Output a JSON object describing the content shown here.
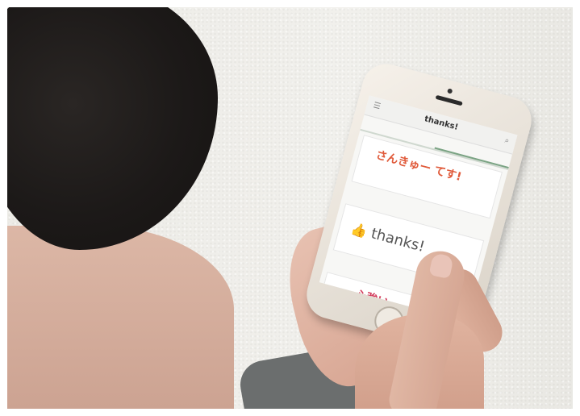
{
  "phone_screen": {
    "app_title": "thanks!",
    "menu_icon": "menu-icon",
    "search_icon": "search-icon",
    "card1_sticker": "さんきゅー てす!",
    "card2_sticker": "thanks!",
    "card3_sticker": "心強い"
  }
}
